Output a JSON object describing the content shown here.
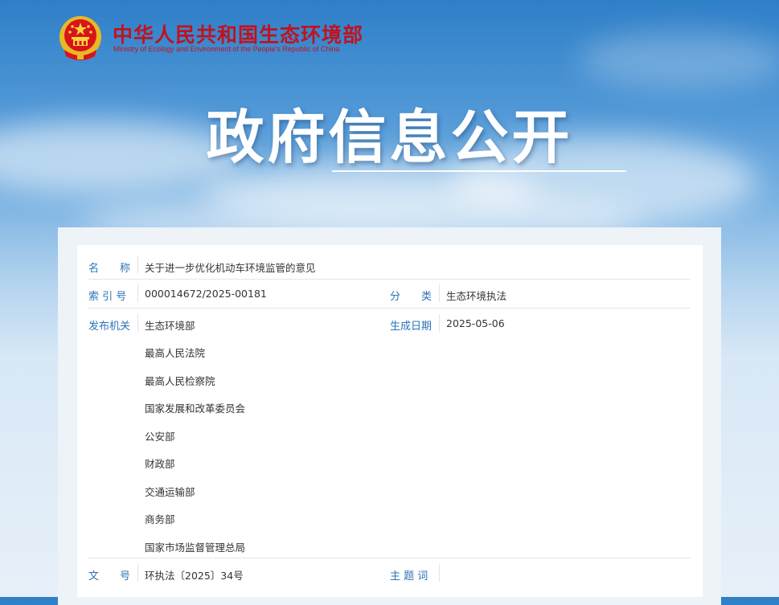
{
  "header": {
    "ministry_cn": "中华人民共和国生态环境部",
    "ministry_en": "Ministry of Ecology and Environment of the People's Republic of China",
    "emblem_icon": "national-emblem-icon"
  },
  "banner": {
    "title": "政府信息公开"
  },
  "info": {
    "name_label": "名　　称",
    "name_value": "关于进一步优化机动车环境监管的意见",
    "index_label": "索 引 号",
    "index_value": "000014672/2025-00181",
    "category_label": "分　　类",
    "category_value": "生态环境执法",
    "issuer_label": "发布机关",
    "issuers": [
      "生态环境部",
      "最高人民法院",
      "最高人民检察院",
      "国家发展和改革委员会",
      "公安部",
      "财政部",
      "交通运输部",
      "商务部",
      "国家市场监督管理总局"
    ],
    "date_label": "生成日期",
    "date_value": "2025-05-06",
    "doc_no_label": "文　　号",
    "doc_no_value": "环执法〔2025〕34号",
    "keywords_label": "主 题 词",
    "keywords_value": ""
  },
  "colors": {
    "ministry_red": "#c1121f",
    "label_blue": "#2c73b8",
    "text": "#333333"
  }
}
